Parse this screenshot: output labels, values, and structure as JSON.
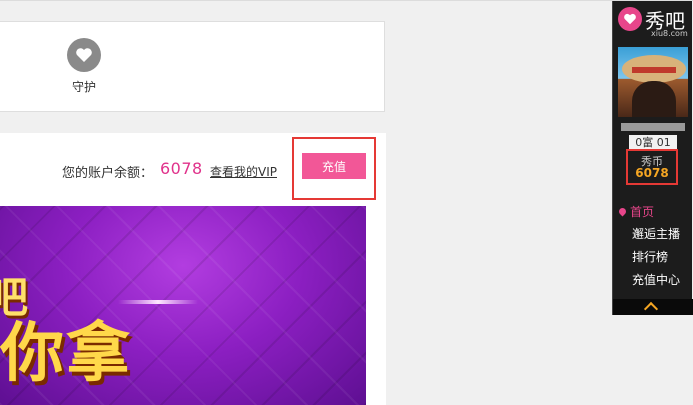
{
  "guard": {
    "label": "守护"
  },
  "account": {
    "balance_label": "您的账户余额：",
    "balance_value": "6078",
    "vip_link": "查看我的VIP",
    "recharge_button": "充值"
  },
  "banner": {
    "text_line1": "吧",
    "text_line2": "你拿"
  },
  "sidebar": {
    "logo_text": "秀吧",
    "logo_sub": "xiu8.com",
    "level": "0富 01",
    "coin_label": "秀币",
    "coin_value": "6078",
    "nav": {
      "home": "首页",
      "items": [
        "邂逅主播",
        "排行榜",
        "充值中心"
      ]
    }
  },
  "colors": {
    "accent_pink": "#f25797",
    "balance_pink": "#e0328b",
    "highlight_red": "#e53935",
    "coin_gold": "#f5a623"
  }
}
